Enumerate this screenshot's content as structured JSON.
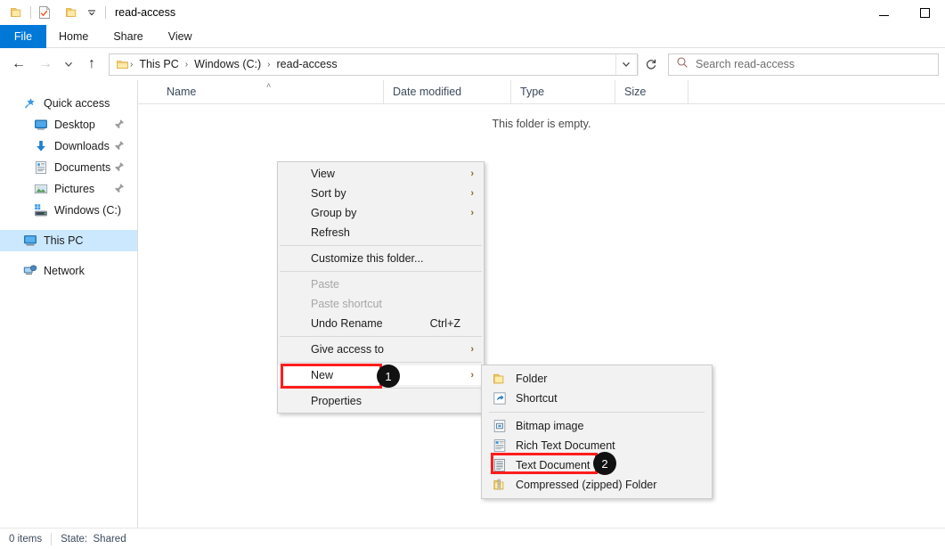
{
  "window": {
    "title": "read-access",
    "quick_access_toolbar": [
      {
        "name": "properties-folder-icon",
        "glyph": "folder"
      },
      {
        "name": "new-folder-check-icon",
        "glyph": "check-doc"
      },
      {
        "name": "customize-folder-icon",
        "glyph": "folder"
      }
    ],
    "dropdown_caret": "–",
    "controls": {
      "minimize": "minimize-button",
      "maximize": "maximize-button"
    }
  },
  "ribbon": {
    "tabs": [
      {
        "label": "File",
        "active": true
      },
      {
        "label": "Home",
        "active": false
      },
      {
        "label": "Share",
        "active": false
      },
      {
        "label": "View",
        "active": false
      }
    ]
  },
  "navigation": {
    "back": "←",
    "forward": "→",
    "recent_locations": "⌵",
    "up": "↑",
    "breadcrumbs": [
      "This PC",
      "Windows (C:)",
      "read-access"
    ],
    "separator": "›",
    "address_dropdown": "⌵",
    "refresh": "⟳"
  },
  "search": {
    "icon": "search-icon",
    "placeholder": "Search read-access",
    "value": ""
  },
  "sidebar": {
    "items": [
      {
        "label": "Quick access",
        "icon": "star-pin-icon",
        "level": 0,
        "pinned": false,
        "selected": false
      },
      {
        "label": "Desktop",
        "icon": "desktop-icon",
        "level": 1,
        "pinned": true,
        "selected": false
      },
      {
        "label": "Downloads",
        "icon": "download-arrow-icon",
        "level": 1,
        "pinned": true,
        "selected": false
      },
      {
        "label": "Documents",
        "icon": "documents-icon",
        "level": 1,
        "pinned": true,
        "selected": false
      },
      {
        "label": "Pictures",
        "icon": "pictures-icon",
        "level": 1,
        "pinned": true,
        "selected": false
      },
      {
        "label": "Windows (C:)",
        "icon": "drive-icon",
        "level": 1,
        "pinned": false,
        "selected": false
      },
      {
        "label": "This PC",
        "icon": "this-pc-icon",
        "level": 0,
        "pinned": false,
        "selected": true
      },
      {
        "label": "Network",
        "icon": "network-icon",
        "level": 0,
        "pinned": false,
        "selected": false
      }
    ]
  },
  "file_list": {
    "columns": [
      {
        "label": "Name",
        "sorted": true,
        "sort_direction": "asc"
      },
      {
        "label": "Date modified",
        "sorted": false
      },
      {
        "label": "Type",
        "sorted": false
      },
      {
        "label": "Size",
        "sorted": false
      }
    ],
    "sort_caret": "˄",
    "empty_message": "This folder is empty.",
    "rows": []
  },
  "status_bar": {
    "segments": [
      "0 items",
      "State:  Shared"
    ]
  },
  "context_menu": {
    "items": [
      {
        "label": "View",
        "submenu": true,
        "disabled": false,
        "accel": "",
        "separator_after": false
      },
      {
        "label": "Sort by",
        "submenu": true,
        "disabled": false,
        "accel": "",
        "separator_after": false
      },
      {
        "label": "Group by",
        "submenu": true,
        "disabled": false,
        "accel": "",
        "separator_after": false
      },
      {
        "label": "Refresh",
        "submenu": false,
        "disabled": false,
        "accel": "",
        "separator_after": true
      },
      {
        "label": "Customize this folder...",
        "submenu": false,
        "disabled": false,
        "accel": "",
        "separator_after": true
      },
      {
        "label": "Paste",
        "submenu": false,
        "disabled": true,
        "accel": "",
        "separator_after": false
      },
      {
        "label": "Paste shortcut",
        "submenu": false,
        "disabled": true,
        "accel": "",
        "separator_after": false
      },
      {
        "label": "Undo Rename",
        "submenu": false,
        "disabled": false,
        "accel": "Ctrl+Z",
        "separator_after": true
      },
      {
        "label": "Give access to",
        "submenu": true,
        "disabled": false,
        "accel": "",
        "separator_after": true
      },
      {
        "label": "New",
        "submenu": true,
        "disabled": false,
        "accel": "",
        "separator_after": true,
        "highlighted": true
      },
      {
        "label": "Properties",
        "submenu": false,
        "disabled": false,
        "accel": "",
        "separator_after": false
      }
    ],
    "submenu_arrow": "›"
  },
  "new_submenu": {
    "items": [
      {
        "label": "Folder",
        "icon": "folder-icon",
        "separator_after": false
      },
      {
        "label": "Shortcut",
        "icon": "shortcut-icon",
        "separator_after": true
      },
      {
        "label": "Bitmap image",
        "icon": "bitmap-image-icon",
        "separator_after": false
      },
      {
        "label": "Rich Text Document",
        "icon": "rich-text-document-icon",
        "separator_after": false
      },
      {
        "label": "Text Document",
        "icon": "text-document-icon",
        "separator_after": false,
        "highlighted": true
      },
      {
        "label": "Compressed (zipped) Folder",
        "icon": "zipped-folder-icon",
        "separator_after": false
      }
    ]
  },
  "annotations": {
    "badges": [
      {
        "number": "1",
        "target": "New"
      },
      {
        "number": "2",
        "target": "Text Document"
      }
    ],
    "highlight_color": "#ff1d1d"
  }
}
